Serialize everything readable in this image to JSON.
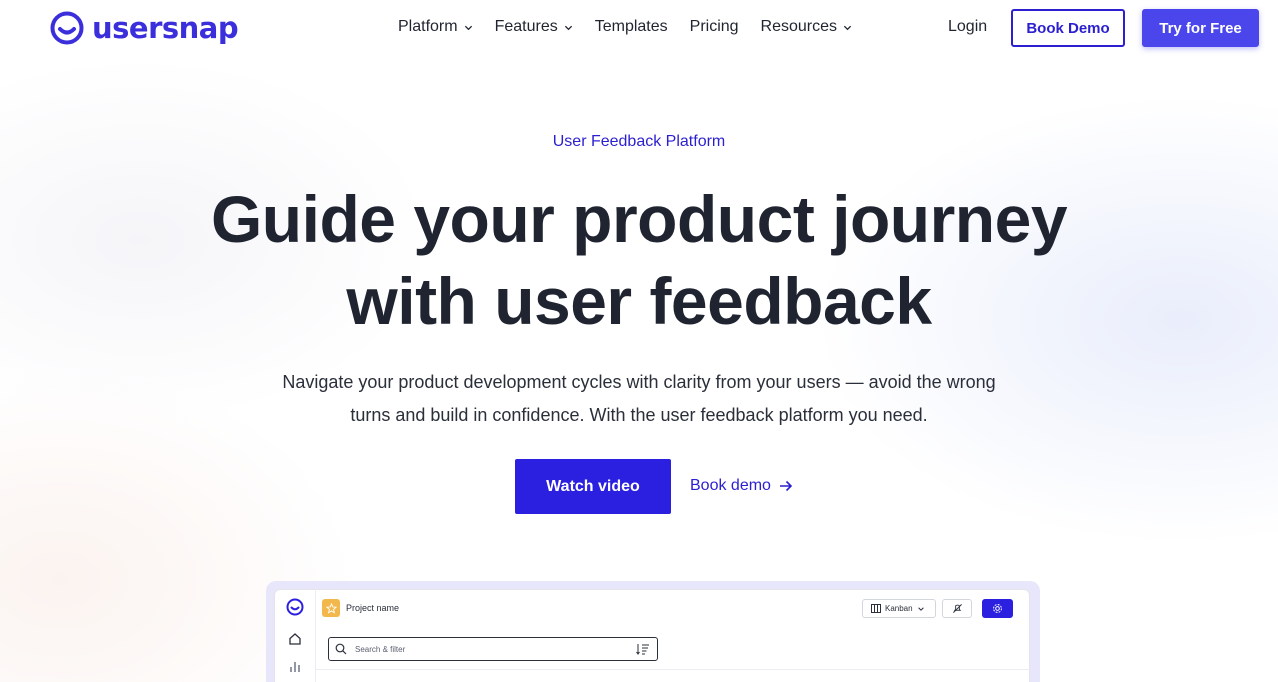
{
  "brand": {
    "name": "usersnap",
    "color": "#3b2fdb"
  },
  "nav": {
    "items": [
      {
        "label": "Platform",
        "has_dropdown": true
      },
      {
        "label": "Features",
        "has_dropdown": true
      },
      {
        "label": "Templates",
        "has_dropdown": false
      },
      {
        "label": "Pricing",
        "has_dropdown": false
      },
      {
        "label": "Resources",
        "has_dropdown": true
      }
    ],
    "login": "Login",
    "book_demo": "Book Demo",
    "try_free": "Try for Free"
  },
  "hero": {
    "eyebrow": "User Feedback Platform",
    "headline_line1": "Guide your product journey",
    "headline_line2": "with user feedback",
    "sub_line1": "Navigate your product development cycles with clarity from your users — avoid the wrong",
    "sub_line2": "turns and build in confidence. With the user feedback platform you need.",
    "watch_video": "Watch video",
    "book_demo_link": "Book demo",
    "accent": "#2b1fe0"
  },
  "preview": {
    "project_name": "Project name",
    "view_select": "Kanban",
    "search_placeholder": "Search & filter",
    "icons": [
      "usersnap-logo-icon",
      "home-icon",
      "bar-chart-icon",
      "star-icon",
      "kanban-icon",
      "mute-icon",
      "gear-icon",
      "search-icon",
      "sort-icon"
    ]
  }
}
